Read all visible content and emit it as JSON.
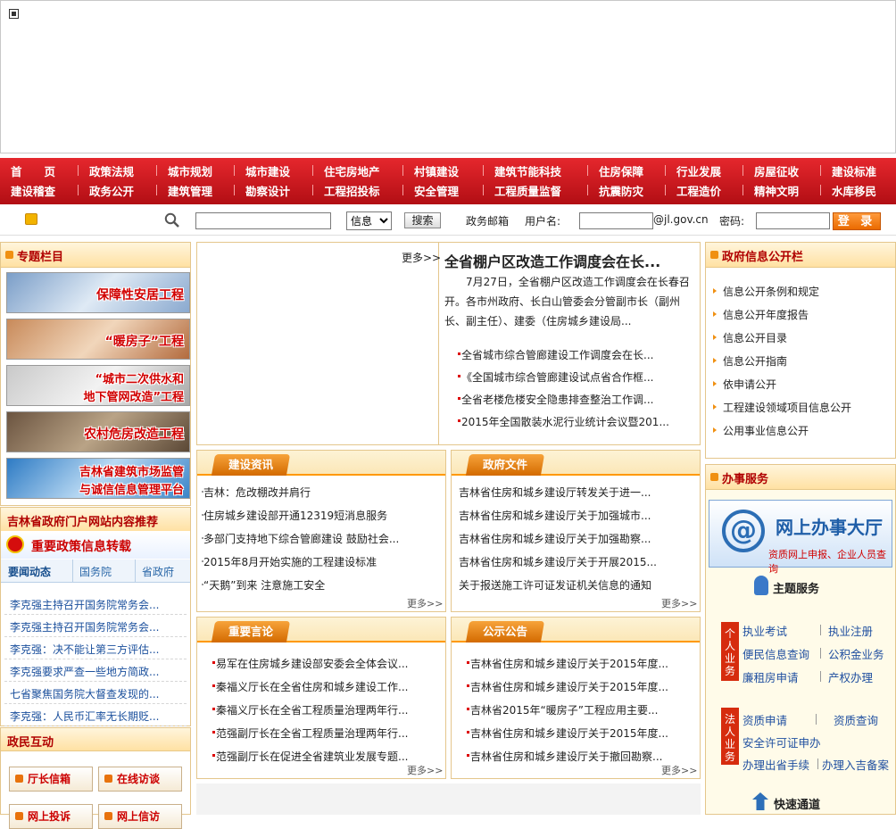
{
  "nav": {
    "row1": [
      "首　　页",
      "政策法规",
      "城市规划",
      "城市建设",
      "住宅房地产",
      "村镇建设",
      "建筑节能科技",
      "住房保障",
      "行业发展",
      "房屋征收",
      "建设标准"
    ],
    "row2": [
      "建设稽查",
      "政务公开",
      "建筑管理",
      "勘察设计",
      "工程招投标",
      "安全管理",
      "工程质量监督",
      "抗震防灾",
      "工程造价",
      "精神文明",
      "水库移民"
    ]
  },
  "search": {
    "select_value": "信息",
    "search_button": "搜索",
    "gov_mail": "政务邮箱",
    "username_label": "用户名:",
    "domain_suffix": "@jl.gov.cn",
    "password_label": "密码:",
    "login_button": "登 录"
  },
  "left": {
    "special_title": "专题栏目",
    "specials": [
      "保障性安居工程",
      "“暖房子”工程",
      "“城市二次供水和\n地下管网改造”工程",
      "农村危房改造工程",
      "吉林省建筑市场监管\n与诚信信息管理平台"
    ],
    "portal_title": "吉林省政府门户网站内容推荐",
    "policy_banner": "重要政策信息转载",
    "tabs": [
      "要闻动态",
      "国务院",
      "省政府"
    ],
    "news": [
      "李克强主持召开国务院常务会...",
      "李克强主持召开国务院常务会...",
      "李克强：决不能让第三方评估...",
      "李克强要求严查一些地方简政...",
      "七省聚焦国务院大督查发现的...",
      "李克强：人民币汇率无长期贬..."
    ],
    "interact_title": "政民互动",
    "interact_buttons": [
      "厅长信箱",
      "在线访谈",
      "网上投诉",
      "网上信访"
    ]
  },
  "center": {
    "more_top": "更多>>",
    "headline": "全省棚户区改造工作调度会在长...",
    "summary": "　　7月27日，全省棚户区改造工作调度会在长春召开。各市州政府、长白山管委会分管副市长（副州长、副主任）、建委（住房城乡建设局...",
    "headline_links": [
      "全省城市综合管廊建设工作调度会在长...",
      "《全国城市综合管廊建设试点省合作框...",
      "全省老楼危楼安全隐患排查整治工作调...",
      "2015年全国散装水泥行业统计会议暨201..."
    ],
    "news_title": "建设资讯",
    "news_items": [
      "吉林：危改棚改并肩行",
      "住房城乡建设部开通12319短消息服务",
      "多部门支持地下综合管廊建设 鼓励社会...",
      "2015年8月开始实施的工程建设标准",
      "“天鹅”到来 注意施工安全"
    ],
    "gov_title": "政府文件",
    "gov_items": [
      "吉林省住房和城乡建设厅转发关于进一...",
      "吉林省住房和城乡建设厅关于加强城市...",
      "吉林省住房和城乡建设厅关于加强勘察...",
      "吉林省住房和城乡建设厅关于开展2015...",
      "关于报送施工许可证发证机关信息的通知"
    ],
    "speech_title": "重要言论",
    "speech_items": [
      "易军在住房城乡建设部安委会全体会议...",
      "秦福义厅长在全省住房和城乡建设工作...",
      "秦福义厅长在全省工程质量治理两年行...",
      "范强副厅长在全省工程质量治理两年行...",
      "范强副厅长在促进全省建筑业发展专题..."
    ],
    "notice_title": "公示公告",
    "notice_items": [
      "吉林省住房和城乡建设厅关于2015年度...",
      "吉林省住房和城乡建设厅关于2015年度...",
      "吉林省2015年“暖房子”工程应用主要...",
      "吉林省住房和城乡建设厅关于2015年度...",
      "吉林省住房和城乡建设厅关于撤回勘察..."
    ],
    "more": "更多>>"
  },
  "right": {
    "info_title": "政府信息公开栏",
    "info_items": [
      "信息公开条例和规定",
      "信息公开年度报告",
      "信息公开目录",
      "信息公开指南",
      "依申请公开",
      "工程建设领域项目信息公开",
      "公用事业信息公开"
    ],
    "service_title": "办事服务",
    "hall_title": "网上办事大厅",
    "hall_sub": "资质网上申报、企业人员查询",
    "theme_title": "主题服务",
    "personal_label": "个人业务",
    "personal_links": [
      "执业考试",
      "执业注册",
      "便民信息查询",
      "公积金业务",
      "廉租房申请",
      "产权办理"
    ],
    "corp_label": "法人业务",
    "corp_links": [
      "资质申请",
      "资质查询",
      "安全许可证申办",
      "办理出省手续",
      "办理入吉备案"
    ],
    "fast_title": "快速通道"
  },
  "colors": {
    "nav_red": "#c8161d",
    "accent_orange": "#f09011",
    "title_red": "#b00000"
  }
}
